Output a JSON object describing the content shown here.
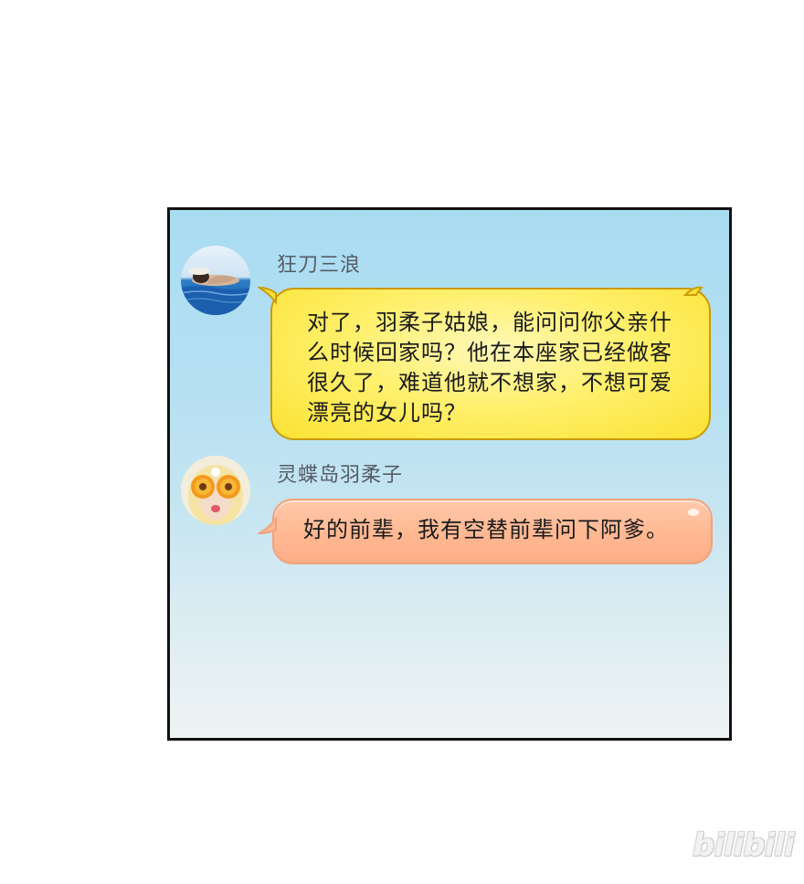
{
  "chat": {
    "messages": [
      {
        "sender": "狂刀三浪",
        "lines": [
          "对了，羽柔子姑娘，能问问你父亲什",
          "么时候回家吗？他在本座家已经做客",
          "很久了，难道他就不想家，不想可爱",
          "漂亮的女儿吗？"
        ],
        "bubble_color": "#fbe233",
        "avatar_icon": "sunbather-in-water-avatar"
      },
      {
        "sender": "灵蝶岛羽柔子",
        "lines": [
          "好的前辈，我有空替前辈问下阿爹。"
        ],
        "bubble_color": "#ffb892",
        "avatar_icon": "girl-with-sunflower-glasses-avatar"
      }
    ]
  },
  "watermark": {
    "text": "bilibili"
  },
  "colors": {
    "panel_top": "#a9dcf2",
    "panel_bottom": "#eef3f4",
    "border": "#111111"
  }
}
